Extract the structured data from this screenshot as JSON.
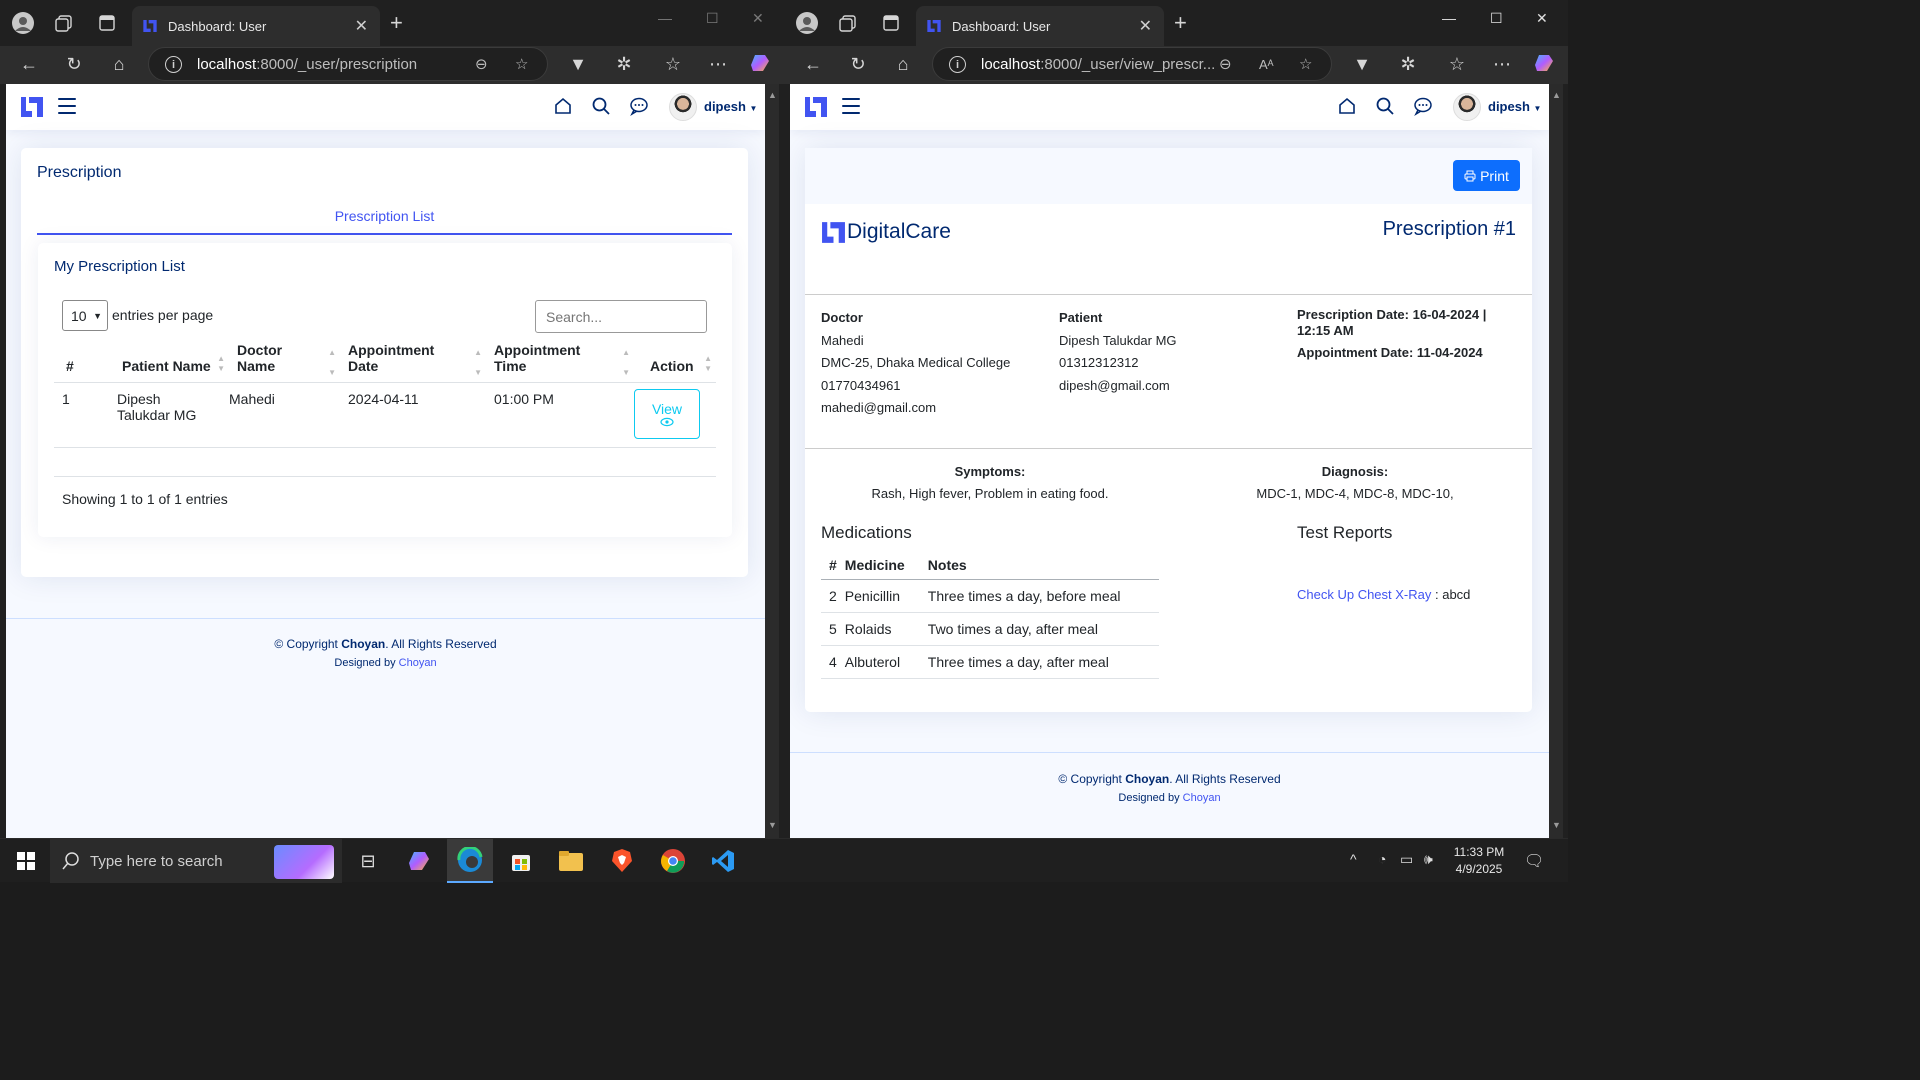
{
  "left": {
    "tab_title": "Dashboard: User",
    "url_host": "localhost",
    "url_rest": ":8000/_user/prescription",
    "user_name": "dipesh",
    "page_title": "Prescription",
    "tab_label": "Prescription List",
    "list_title": "My Prescription List",
    "entries_value": "10",
    "entries_label": "entries per page",
    "search_placeholder": "Search...",
    "columns": [
      "#",
      "Patient Name",
      "Doctor Name",
      "Appointment Date",
      "Appointment Time",
      "Action"
    ],
    "rows": [
      {
        "num": "1",
        "patient": "Dipesh Talukdar MG",
        "doctor": "Mahedi",
        "date": "2024-04-11",
        "time": "01:00 PM",
        "action": "View"
      }
    ],
    "showing": "Showing 1 to 1 of 1 entries",
    "footer_copy": "© Copyright ",
    "footer_brand": "Choyan",
    "footer_rights": ". All Rights Reserved",
    "footer_designed": "Designed by ",
    "footer_designer": "Choyan"
  },
  "right": {
    "tab_title": "Dashboard: User",
    "url_host": "localhost",
    "url_rest": ":8000/_user/view_prescr...",
    "user_name": "dipesh",
    "print_label": "Print",
    "brand": "DigitalCare",
    "prescription_title": "Prescription #1",
    "doctor": {
      "label": "Doctor",
      "name": "Mahedi",
      "place": "DMC-25, Dhaka Medical College",
      "phone": "01770434961",
      "email": "mahedi@gmail.com"
    },
    "patient": {
      "label": "Patient",
      "name": "Dipesh Talukdar MG",
      "phone": "01312312312",
      "email": "dipesh@gmail.com"
    },
    "prescription_date": "Prescription Date: 16-04-2024 | 12:15 AM",
    "appointment_date": "Appointment Date: 11-04-2024",
    "symptoms_label": "Symptoms:",
    "symptoms": "Rash, High fever, Problem in eating food.",
    "diagnosis_label": "Diagnosis:",
    "diagnosis": "MDC-1, MDC-4, MDC-8, MDC-10,",
    "medications_title": "Medications",
    "med_columns": [
      "#",
      "Medicine",
      "Notes"
    ],
    "medications": [
      {
        "num": "2",
        "name": "Penicillin",
        "notes": "Three times a day, before meal"
      },
      {
        "num": "5",
        "name": "Rolaids",
        "notes": "Two times a day, after meal"
      },
      {
        "num": "4",
        "name": "Albuterol",
        "notes": "Three times a day, after meal"
      }
    ],
    "test_reports_title": "Test Reports",
    "test_report_link": "Check Up Chest X-Ray",
    "test_report_value": " : abcd",
    "footer_copy": "© Copyright ",
    "footer_brand": "Choyan",
    "footer_rights": ". All Rights Reserved",
    "footer_designed": "Designed by ",
    "footer_designer": "Choyan"
  },
  "taskbar": {
    "search_placeholder": "Type here to search",
    "time": "11:33 PM",
    "date": "4/9/2025"
  },
  "colors": {
    "brand": "#012970",
    "accent": "#4154f1",
    "info": "#0dcaf0",
    "print_btn": "#0d6efd"
  }
}
